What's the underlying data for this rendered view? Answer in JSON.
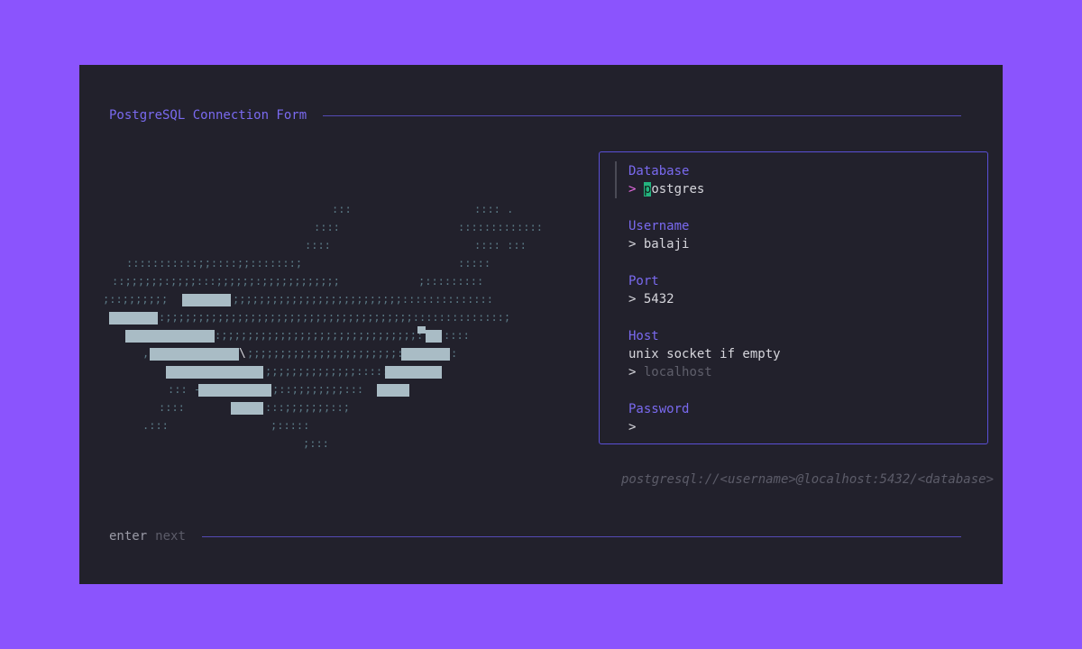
{
  "header": {
    "title": "PostgreSQL Connection Form"
  },
  "form": {
    "database": {
      "label": "Database",
      "prompt": ">",
      "value_first": "p",
      "value_rest": "ostgres"
    },
    "username": {
      "label": "Username",
      "prompt": ">",
      "value": "balaji"
    },
    "port": {
      "label": "Port",
      "prompt": ">",
      "value": "5432"
    },
    "host": {
      "label": "Host",
      "hint": "unix socket if empty",
      "prompt": ">",
      "placeholder": "localhost"
    },
    "password": {
      "label": "Password",
      "prompt": ">",
      "value": ""
    }
  },
  "connection_string": "postgresql://<username>@localhost:5432/<database>",
  "footer": {
    "key": "enter",
    "action": "next"
  },
  "colors": {
    "background": "#8b54fd",
    "panel": "#22212c",
    "accent": "#7a6af0",
    "cursor": "#24b37f",
    "art_dots": "#5b7a86",
    "art_blocks": "#a9bcc5"
  },
  "icons": [
    "elephant-ascii-art"
  ]
}
